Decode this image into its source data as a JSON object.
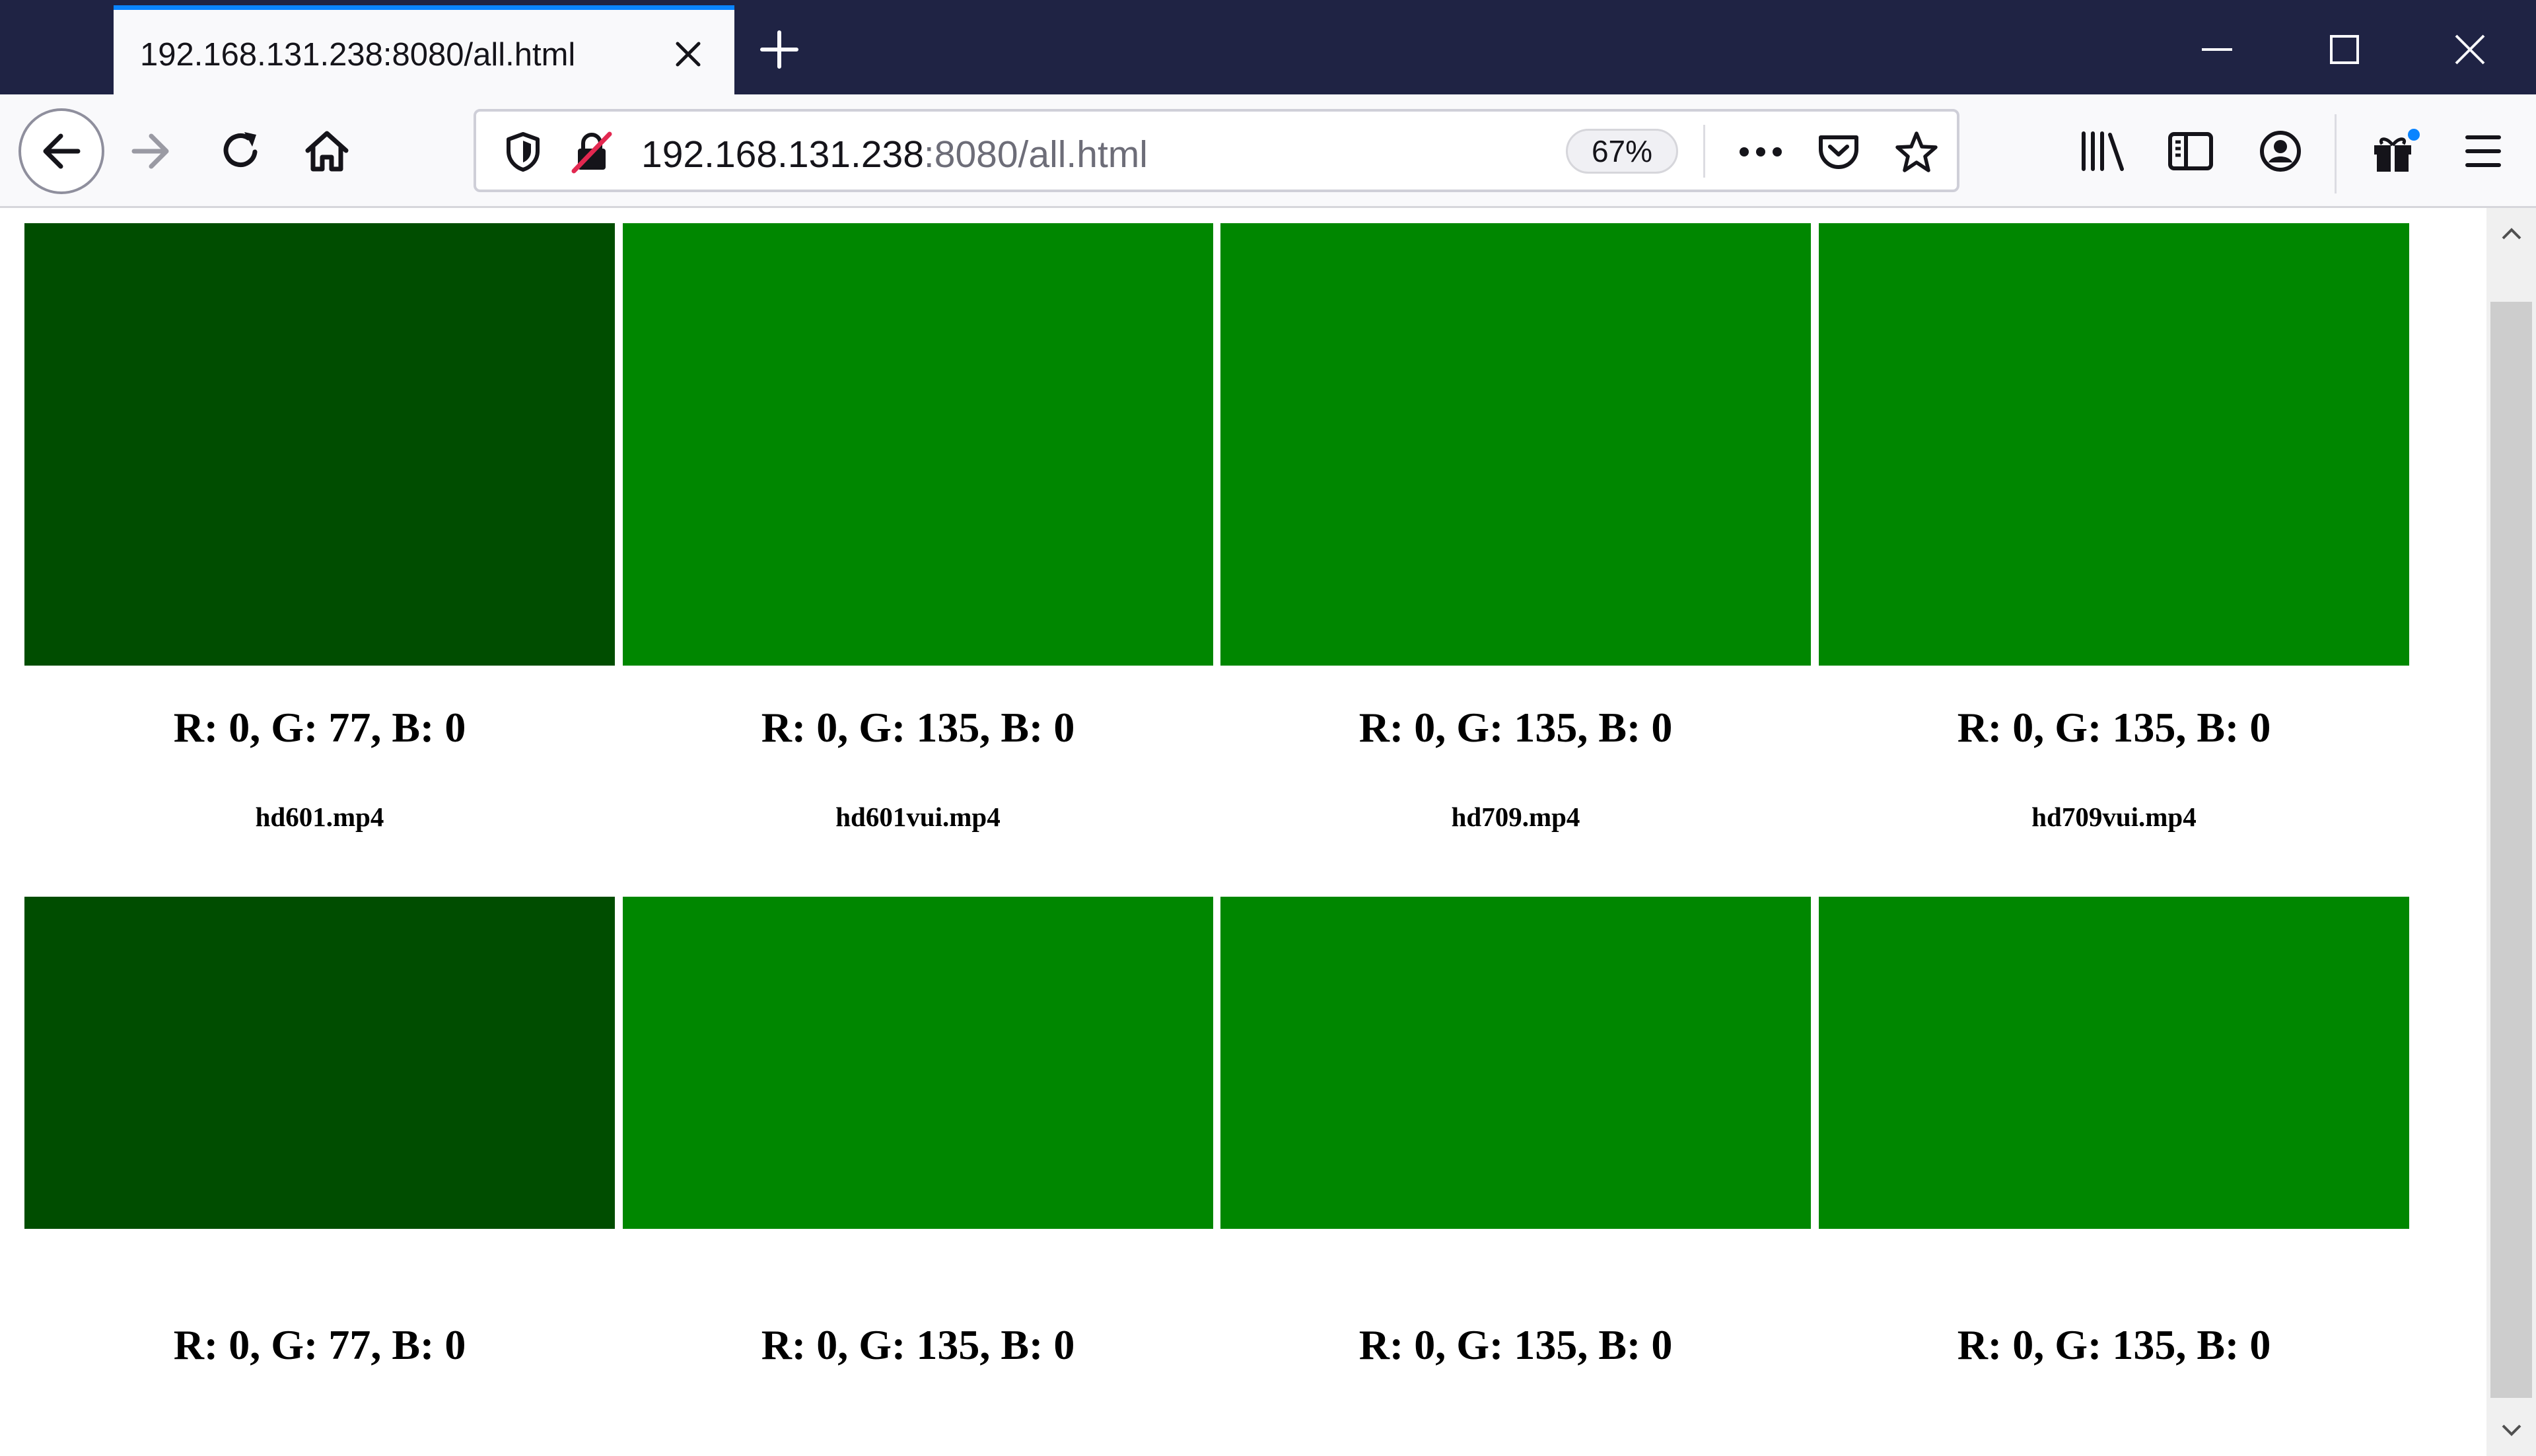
{
  "browser": {
    "tab_title": "192.168.131.238:8080/all.html",
    "url_host": "192.168.131.238",
    "url_rest": ":8080/all.html",
    "zoom": "67%",
    "accent": "#0a84ff"
  },
  "icons": {
    "window_controls": [
      "minimize-icon",
      "maximize-icon",
      "close-icon"
    ],
    "nav": [
      "back-arrow-icon",
      "forward-arrow-icon",
      "reload-icon",
      "home-icon"
    ],
    "url_bar": [
      "tracking-shield-icon",
      "insecure-lock-icon",
      "more-actions-icon",
      "pocket-icon",
      "bookmark-star-icon"
    ],
    "toolbar": [
      "library-icon",
      "sidebar-icon",
      "account-icon",
      "whats-new-gift-icon",
      "menu-icon"
    ]
  },
  "grid": {
    "rows": [
      {
        "cells": [
          {
            "color": "#004d00",
            "rgb": "R: 0, G: 77, B: 0",
            "file": "hd601.mp4"
          },
          {
            "color": "#008700",
            "rgb": "R: 0, G: 135, B: 0",
            "file": "hd601vui.mp4"
          },
          {
            "color": "#008700",
            "rgb": "R: 0, G: 135, B: 0",
            "file": "hd709.mp4"
          },
          {
            "color": "#008700",
            "rgb": "R: 0, G: 135, B: 0",
            "file": "hd709vui.mp4"
          }
        ]
      },
      {
        "cells": [
          {
            "color": "#004d00",
            "rgb": "R: 0, G: 77, B: 0"
          },
          {
            "color": "#008700",
            "rgb": "R: 0, G: 135, B: 0"
          },
          {
            "color": "#008700",
            "rgb": "R: 0, G: 135, B: 0"
          },
          {
            "color": "#008700",
            "rgb": "R: 0, G: 135, B: 0"
          }
        ]
      }
    ]
  }
}
